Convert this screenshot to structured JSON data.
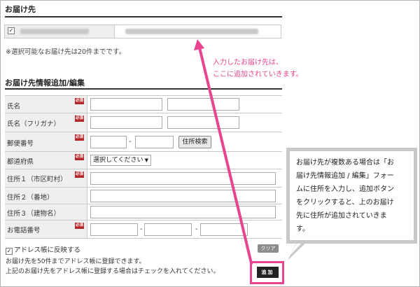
{
  "delivery": {
    "title": "お届け先",
    "checked_mark": "✓",
    "note": "※選択可能なお届け先は20件までです。"
  },
  "form": {
    "title": "お届け先情報追加/編集",
    "required_badge": "必須",
    "rows": [
      {
        "label": "氏名"
      },
      {
        "label": "氏名（フリガナ）"
      },
      {
        "label": "郵便番号"
      },
      {
        "label": "都道府県"
      },
      {
        "label": "住所１（市区町村）"
      },
      {
        "label": "住所２（番地）"
      },
      {
        "label": "住所３（建物名）"
      },
      {
        "label": "お電話番号"
      }
    ],
    "dash": "-",
    "address_search_button": "住所検索",
    "prefecture_select": "選択してください"
  },
  "address_book": {
    "checkbox_label": "アドレス帳に反映する",
    "checked_mark": "✓",
    "note1": "お届け先を50件までアドレス帳に登録できます。",
    "note2": "上記のお届け先をアドレス帳に登録する場合はチェックを入れてください。"
  },
  "buttons": {
    "clear": "クリア",
    "add": "追加"
  },
  "annotations": {
    "pink_line1": "入力したお届け先は、",
    "pink_line2": "ここに追加されていきます。",
    "callout_lines": [
      "お届け先が複数ある場合は「お",
      "届け先情報追加 / 編集」フォー",
      "ムに住所を入力し、追加ボタン",
      "をクリックすると、上のお届け",
      "先に住所が追加されていきま",
      "す。"
    ]
  },
  "colors": {
    "accent_pink": "#e8458e",
    "required_red": "#b5262b"
  }
}
